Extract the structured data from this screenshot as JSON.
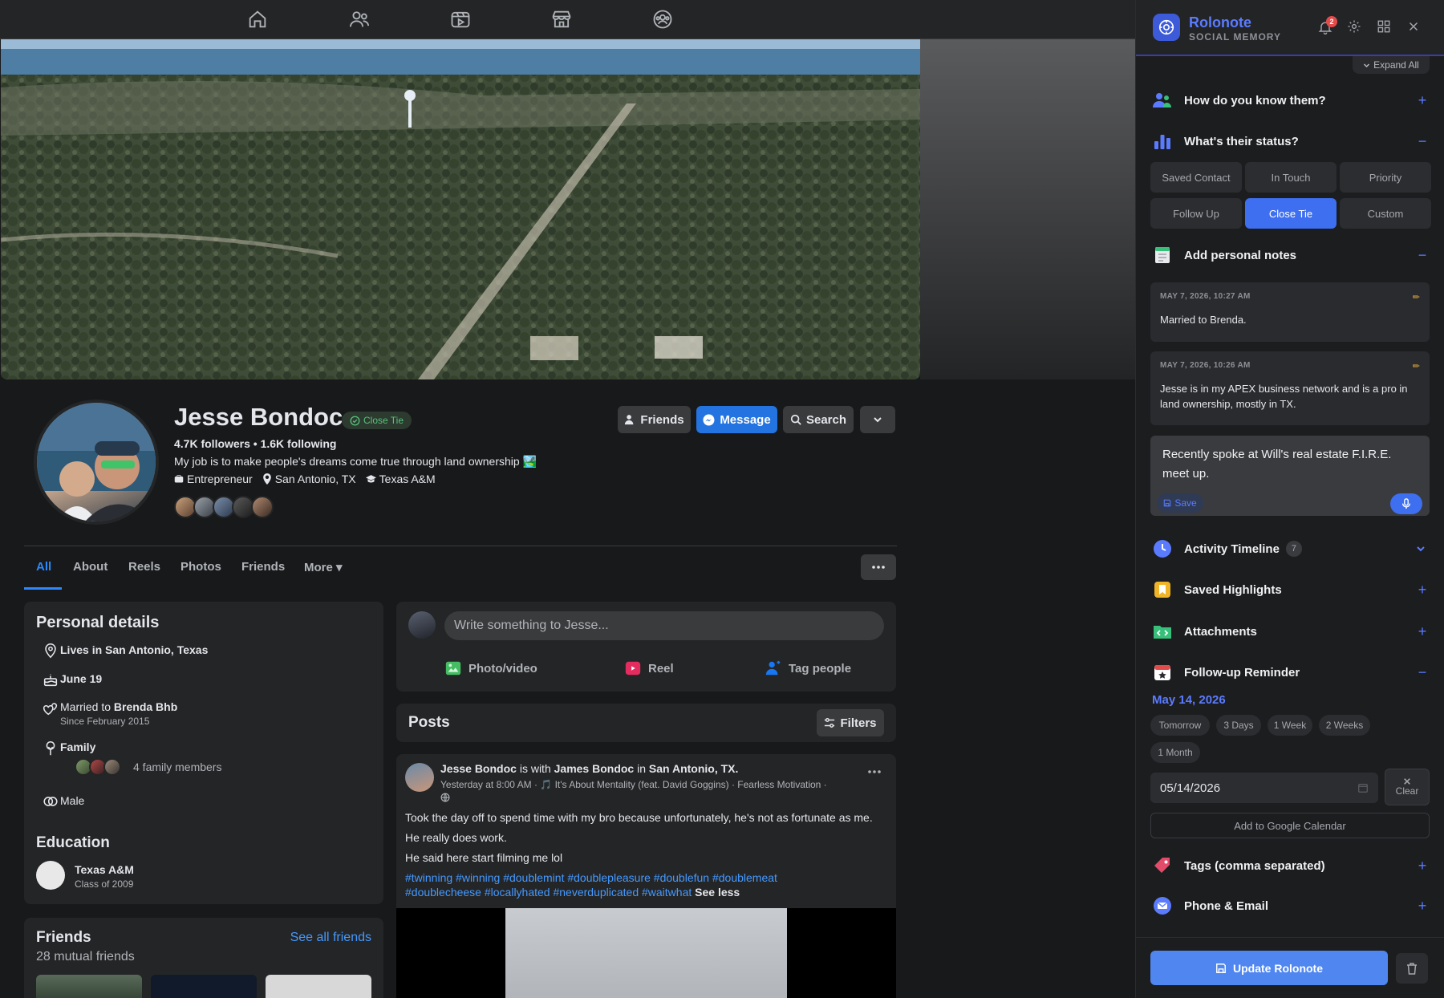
{
  "topnav": {
    "icons": [
      "home-icon",
      "friends-icon",
      "watch-icon",
      "marketplace-icon",
      "groups-icon"
    ]
  },
  "profile": {
    "name": "Jesse Bondoc",
    "badge": "Close Tie",
    "stats": "4.7K followers • 1.6K following",
    "bio": "My job is to make people's dreams come true through land ownership 🏞️",
    "work": "Entrepreneur",
    "location": "San Antonio, TX",
    "school": "Texas A&M",
    "buttons": {
      "friends": "Friends",
      "message": "Message",
      "search": "Search"
    }
  },
  "tabs": [
    "All",
    "About",
    "Reels",
    "Photos",
    "Friends",
    "More ▾"
  ],
  "personal": {
    "title": "Personal details",
    "lives": "Lives in San Antonio, Texas",
    "birthday": "June 19",
    "married_prefix": "Married to ",
    "married_name": "Brenda Bhb",
    "married_since": "Since February 2015",
    "family_label": "Family",
    "family_count": "4 family members",
    "gender": "Male",
    "education_title": "Education",
    "school": "Texas A&M",
    "school_class": "Class of 2009"
  },
  "friends": {
    "title": "Friends",
    "see_all": "See all friends",
    "mutual": "28 mutual friends"
  },
  "composer": {
    "placeholder": "Write something to Jesse...",
    "photo": "Photo/video",
    "reel": "Reel",
    "tag": "Tag people"
  },
  "posts": {
    "title": "Posts",
    "filters": "Filters"
  },
  "post": {
    "author": "Jesse Bondoc",
    "with_text": " is with ",
    "with_name": "James Bondoc",
    "in_text": " in ",
    "place": "San Antonio, TX.",
    "meta": "Yesterday at 8:00 AM · 🎵 It's About Mentality (feat. David Goggins) · Fearless Motivation ·",
    "line1": "Took the day off to spend time with my bro because unfortunately, he's not as fortunate as me.",
    "line2": "He really does work.",
    "line3": "He said here start filming me lol",
    "hashtags1": "#twinning #winning #doublemint #doublepleasure #doublefun #doublemeat",
    "hashtags2": "#doublecheese #locallyhated #neverduplicated #waitwhat",
    "see_less": "See less"
  },
  "panel": {
    "brand": "Rolonote",
    "brand_sub": "SOCIAL MEMORY",
    "notif_count": "2",
    "expand_all": "Expand All",
    "sections": {
      "know": "How do you know them?",
      "status": "What's their status?",
      "notes": "Add personal notes",
      "timeline": "Activity Timeline",
      "timeline_count": "7",
      "highlights": "Saved Highlights",
      "attachments": "Attachments",
      "reminder": "Follow-up Reminder",
      "tags": "Tags (comma separated)",
      "phone": "Phone & Email"
    },
    "status_options": [
      "Saved Contact",
      "In Touch",
      "Priority",
      "Follow Up",
      "Close Tie",
      "Custom"
    ],
    "status_selected": "Close Tie",
    "notes": [
      {
        "date": "MAY 7, 2026, 10:27 AM",
        "text": "Married to Brenda."
      },
      {
        "date": "MAY 7, 2026, 10:26 AM",
        "text": "Jesse is in my APEX business network and is a pro in land ownership, mostly in TX."
      }
    ],
    "draft_note": "Recently spoke at Will's real estate F.I.R.E. meet up.",
    "save": "Save",
    "reminder_date": "May 14, 2026",
    "quick_chips": [
      "Tomorrow",
      "3 Days",
      "1 Week",
      "2 Weeks",
      "1 Month"
    ],
    "date_value": "05/14/2026",
    "clear": "Clear",
    "gcal": "Add to Google Calendar",
    "update": "Update Rolonote"
  }
}
